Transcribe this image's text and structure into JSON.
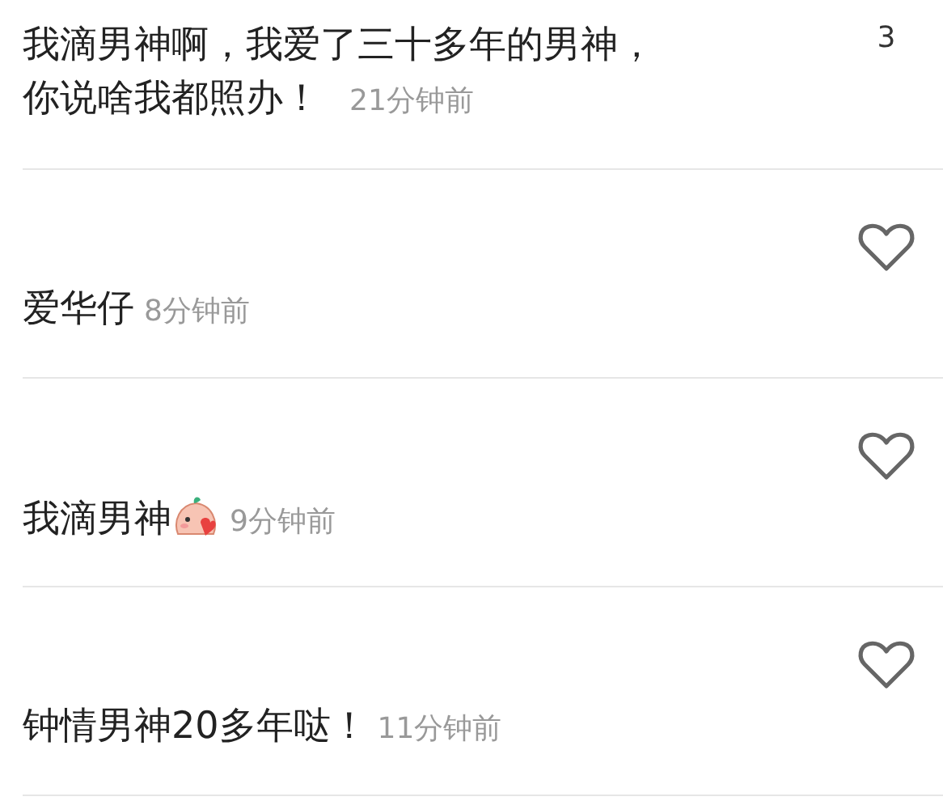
{
  "comments": [
    {
      "kind": "count",
      "lines": [
        "我滴男神啊，我爱了三十多年的男神，",
        "你说啥我都照办！"
      ],
      "time": "21分钟前",
      "likes": "3"
    },
    {
      "kind": "heart",
      "lines": [
        "爱华仔"
      ],
      "time": "8分钟前"
    },
    {
      "kind": "heart",
      "lines": [
        "我滴男神"
      ],
      "time": "9分钟前",
      "has_sticker": true
    },
    {
      "kind": "heart",
      "lines": [
        "钟情男神20多年哒！"
      ],
      "time": "11分钟前"
    }
  ]
}
